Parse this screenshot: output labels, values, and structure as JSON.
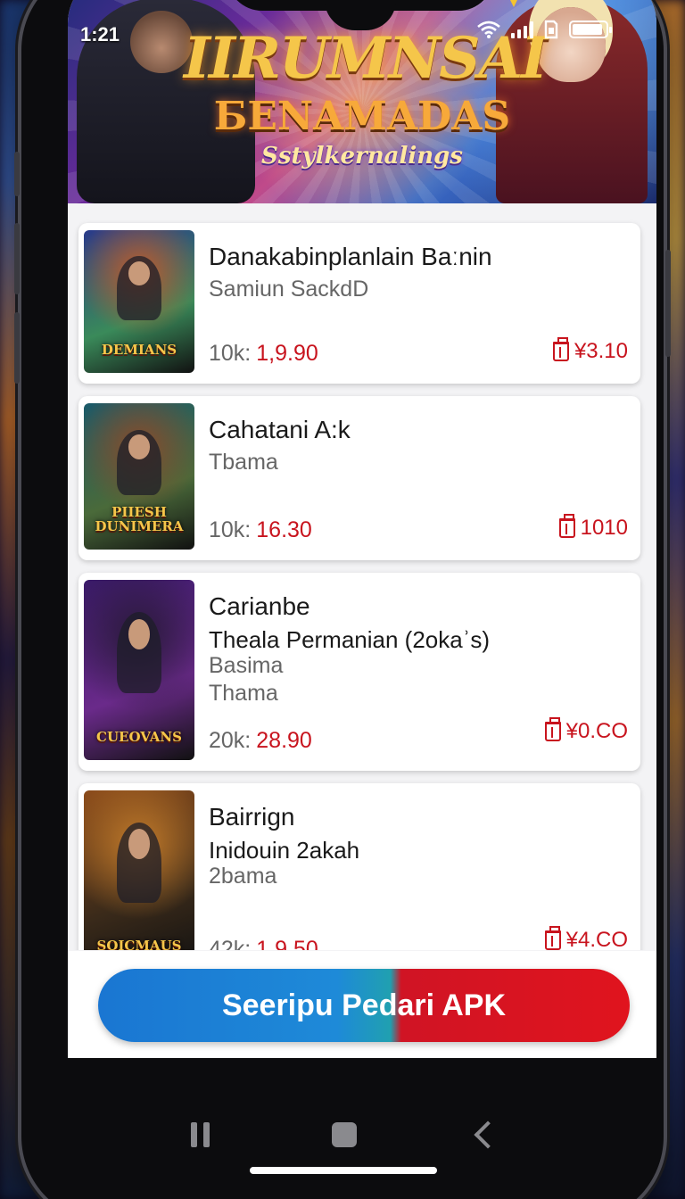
{
  "status_bar": {
    "time": "1:21"
  },
  "banner": {
    "title": "IIRUMNSAI",
    "subtitle": "БENAMADAS",
    "tagline": "Sstylkernalings"
  },
  "apps": [
    {
      "title": "Danakabinplanlain Baːnin",
      "lines": [],
      "subtitles": [
        "Samiun SackdD"
      ],
      "price_label": "10k:",
      "price_value": "1,9.90",
      "cost": "¥3.10",
      "thumb_text": "DEMIANS",
      "thumb_colors": [
        "#2a3a8a",
        "#3a8a5a",
        "#c05a2a"
      ]
    },
    {
      "title": "Cahatani A:k",
      "lines": [],
      "subtitles": [
        "Tbama"
      ],
      "price_label": "10k:",
      "price_value": "16.30",
      "cost": "1010",
      "thumb_text": "PIIESH DUNIMERA",
      "thumb_colors": [
        "#1a5a6a",
        "#4a6a3a",
        "#8a4a2a"
      ]
    },
    {
      "title": "Carianbe",
      "lines": [
        "Theala Permanian (2okaʾs)"
      ],
      "subtitles": [
        "Basima",
        "Thama"
      ],
      "price_label": "20k:",
      "price_value": "28.90",
      "cost": "¥0.CO",
      "thumb_text": "CUEOVANS",
      "thumb_colors": [
        "#3a1a6a",
        "#6a2a8a",
        "#2a1a3a"
      ]
    },
    {
      "title": "Bairrign",
      "lines": [
        "Inidouin 2akah"
      ],
      "subtitles": [
        "2bama"
      ],
      "price_label": "42k:",
      "price_value": "1.9.50",
      "cost": "¥4.CO",
      "thumb_text": "SOICMAUS",
      "thumb_colors": [
        "#8a4a1a",
        "#3a2a1a",
        "#c07a2a"
      ]
    }
  ],
  "cta": {
    "label": "Seeripu Pedari APK"
  },
  "colors": {
    "accent_red": "#c8141e",
    "cta_blue": "#1a76d2",
    "cta_red": "#e0141e"
  }
}
